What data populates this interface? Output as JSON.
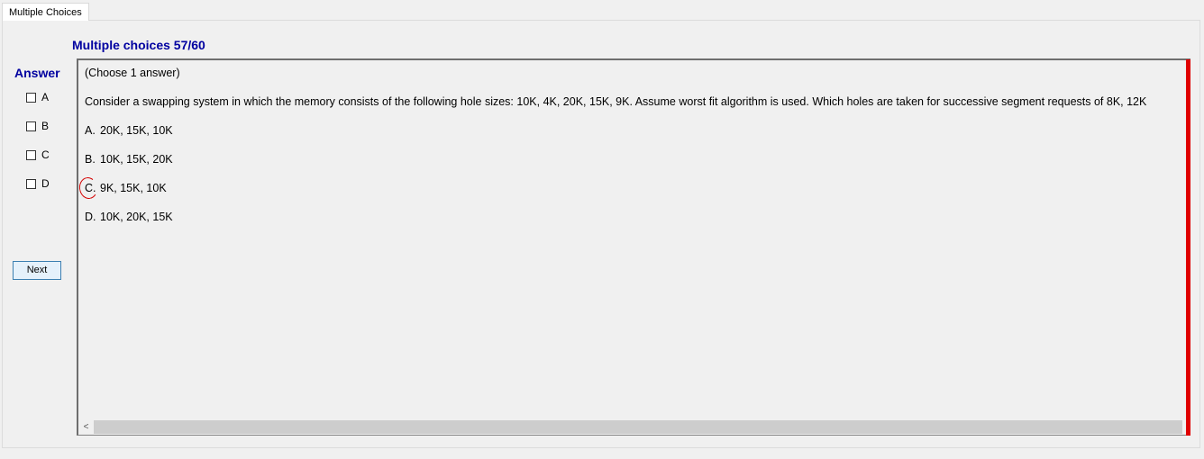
{
  "tab": {
    "label": "Multiple Choices"
  },
  "header": {
    "title": "Multiple choices 57/60"
  },
  "answer_panel": {
    "label": "Answer",
    "options": [
      {
        "label": "A",
        "checked": false
      },
      {
        "label": "B",
        "checked": false
      },
      {
        "label": "C",
        "checked": false
      },
      {
        "label": "D",
        "checked": false
      }
    ],
    "next_label": "Next"
  },
  "question": {
    "instruction": "(Choose 1 answer)",
    "text": "Consider a swapping system in which the memory consists of the following hole sizes: 10K, 4K, 20K, 15K, 9K. Assume worst fit algorithm is used. Which holes are taken for successive segment requests of 8K, 12K",
    "answers": [
      {
        "key": "A.",
        "text": "20K, 15K, 10K"
      },
      {
        "key": "B.",
        "text": "10K, 15K, 20K"
      },
      {
        "key": "C.",
        "text": "9K, 15K, 10K",
        "annotated": true
      },
      {
        "key": "D.",
        "text": "10K, 20K, 15K"
      }
    ]
  },
  "scrollbar": {
    "left_arrow": "<"
  },
  "colors": {
    "title": "#0000a0",
    "annotation": "#d40000",
    "accent_bar": "#e00000"
  }
}
